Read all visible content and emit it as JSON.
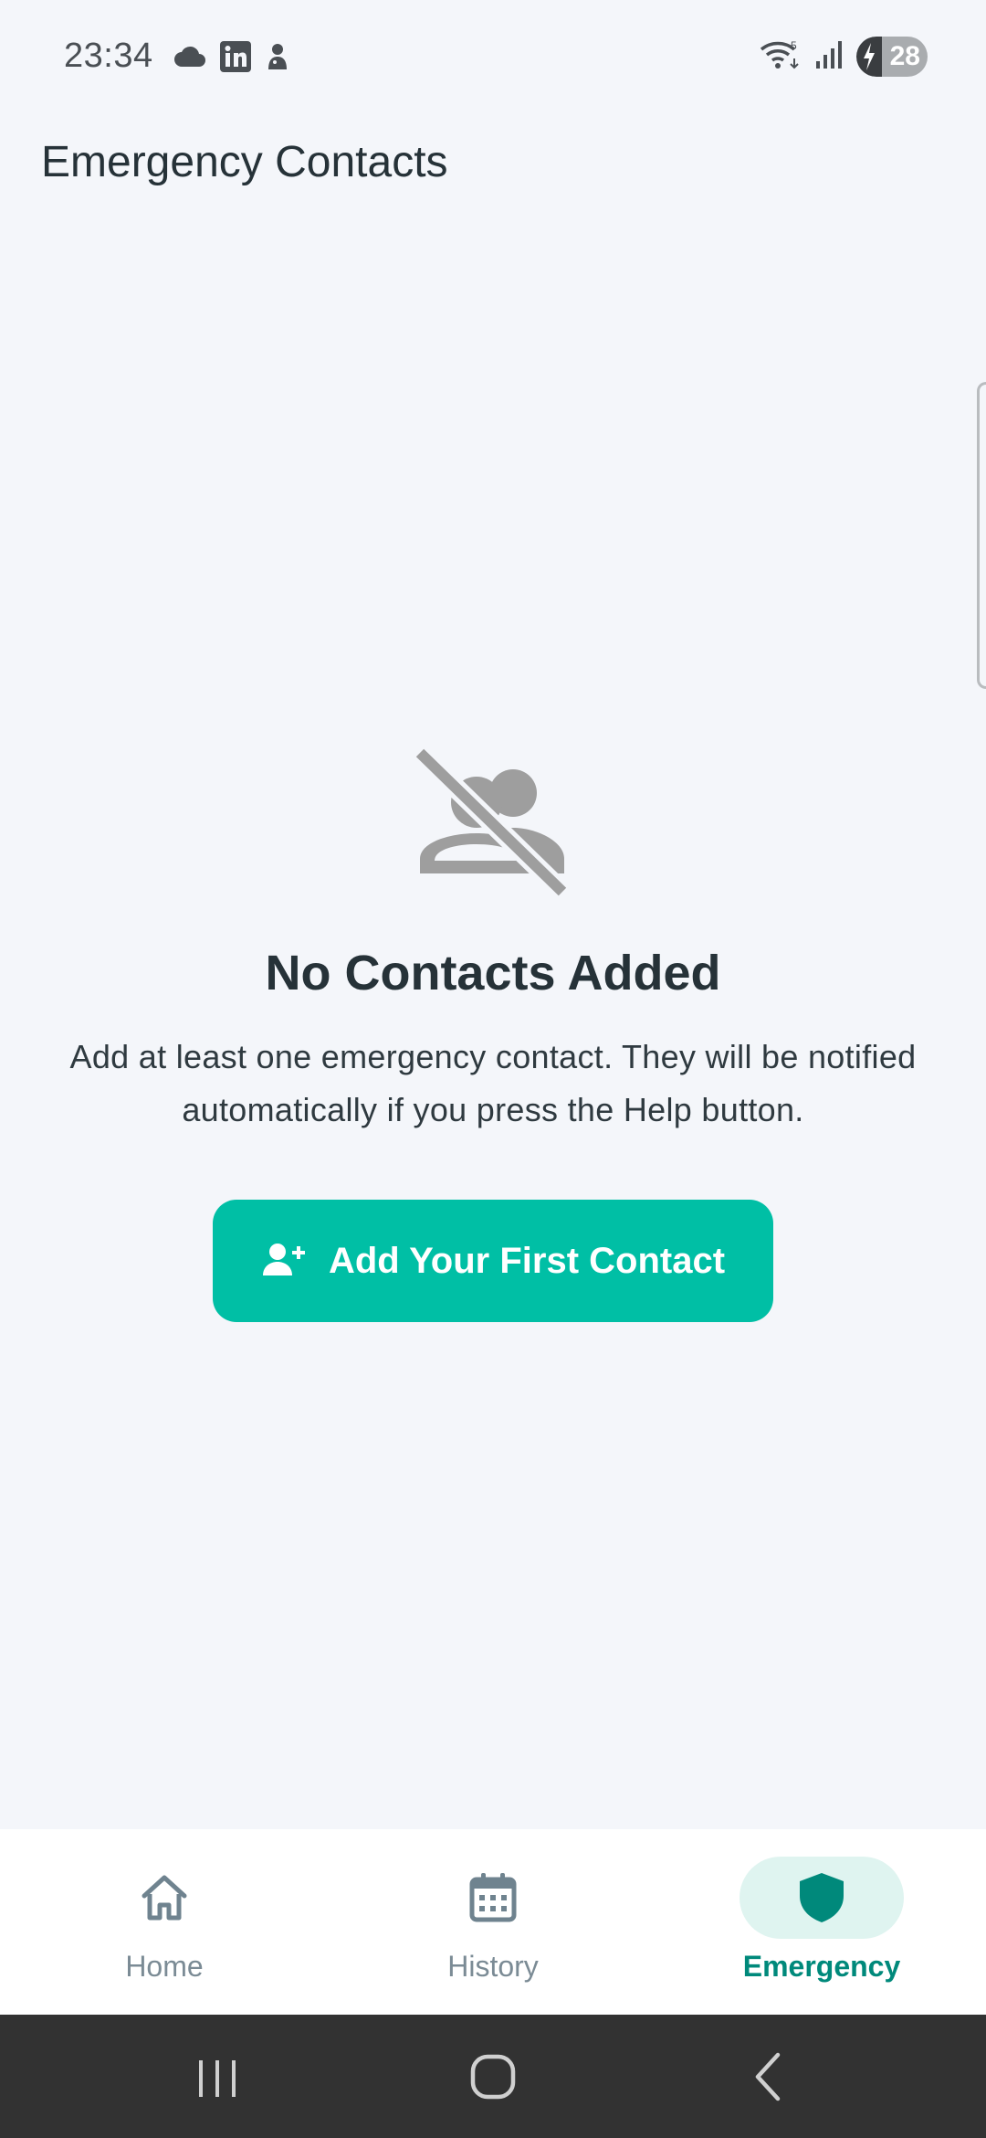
{
  "status_bar": {
    "time": "23:34",
    "left_icons": [
      "cloud-icon",
      "linkedin-icon",
      "notification-app-icon"
    ],
    "right_icons": [
      "wifi-icon",
      "signal-icon",
      "battery-icon"
    ],
    "battery_level": "28"
  },
  "header": {
    "title": "Emergency Contacts"
  },
  "empty_state": {
    "icon": "no-contacts-icon",
    "title": "No Contacts Added",
    "description": "Add at least one emergency contact. They will be notified automatically if you press the Help button.",
    "button_label": "Add Your First Contact",
    "button_icon": "person-add-icon"
  },
  "bottom_nav": {
    "items": [
      {
        "label": "Home",
        "icon": "home-icon",
        "active": false
      },
      {
        "label": "History",
        "icon": "calendar-icon",
        "active": false
      },
      {
        "label": "Emergency",
        "icon": "shield-icon",
        "active": true
      }
    ]
  },
  "system_nav": {
    "buttons": [
      "recents-button",
      "home-button",
      "back-button"
    ]
  },
  "colors": {
    "accent": "#00bfa5",
    "active_nav": "#00897b",
    "background": "#f4f6fa",
    "nav_pill": "#dff4f0",
    "muted_icon": "#9e9e9e"
  }
}
